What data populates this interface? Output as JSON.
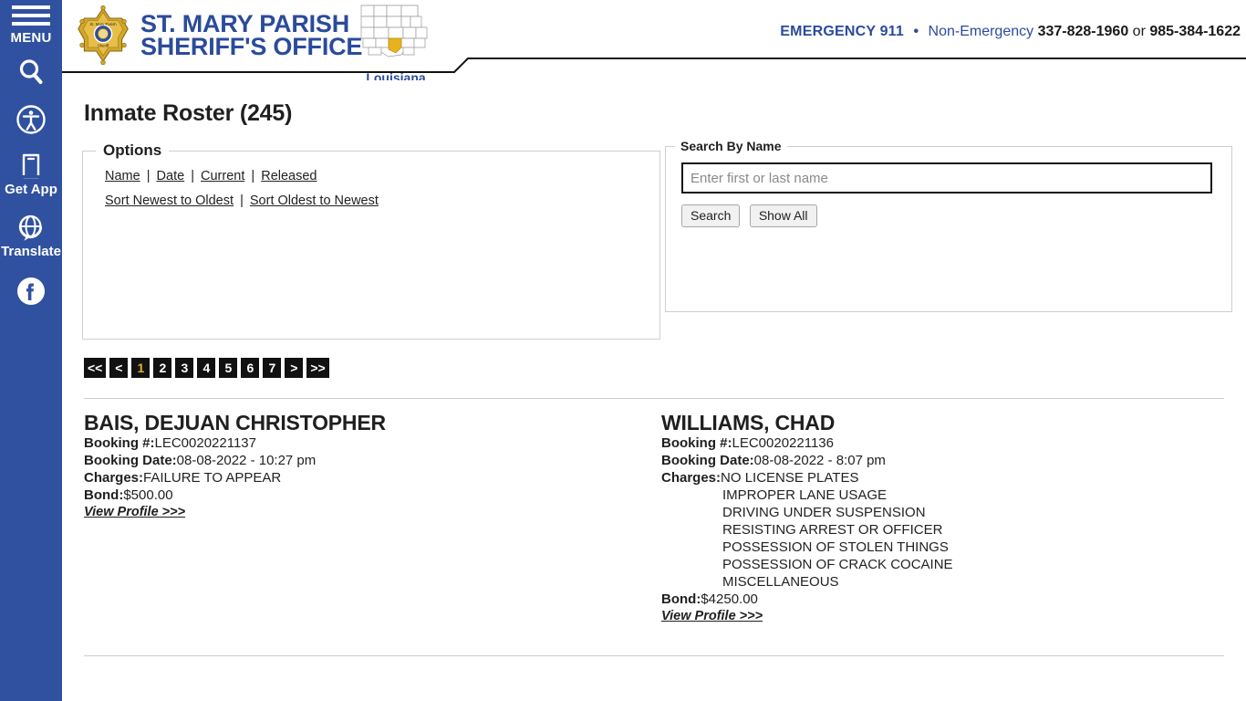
{
  "rail": {
    "menu_label": "MENU",
    "menu_icon": "hamburger-menu-icon",
    "search_icon": "search-icon",
    "items": [
      {
        "icon": "accessibility-icon",
        "label": ""
      },
      {
        "icon": "mobile-app-icon",
        "label": "Get App"
      },
      {
        "icon": "translate-globe-icon",
        "label": "Translate"
      },
      {
        "icon": "facebook-icon",
        "label": ""
      }
    ]
  },
  "header": {
    "badge_icon": "sheriff-star-badge-icon",
    "brand_line1": "ST. MARY PARISH",
    "brand_line2": "SHERIFF'S OFFICE",
    "state_map_icon": "louisiana-map-icon",
    "state_caption": "Louisiana",
    "emergency_label": "EMERGENCY 911",
    "separator": "•",
    "non_emergency_label": "Non-Emergency",
    "phone_primary": "337-828-1960",
    "conjunction": "or",
    "phone_secondary": "985-384-1622",
    "brand_color": "#2B4B9B",
    "rail_color": "#30519F"
  },
  "main": {
    "page_title": "Inmate Roster (245)",
    "options": {
      "legend": "Options",
      "filters": [
        "Name",
        "Date",
        "Current",
        "Released"
      ],
      "sorts": [
        "Sort Newest to Oldest",
        "Sort Oldest to Newest"
      ],
      "separator": "|"
    },
    "search": {
      "legend": "Search By Name",
      "input_value": "",
      "placeholder": "Enter first or last name",
      "search_button": "Search",
      "show_all_button": "Show All"
    },
    "pagination": {
      "first": "<<",
      "prev": "<",
      "pages": [
        "1",
        "2",
        "3",
        "4",
        "5",
        "6",
        "7"
      ],
      "current": "1",
      "next": ">",
      "last": ">>",
      "active_color": "#E8B21C"
    },
    "labels": {
      "booking_number": "Booking #:",
      "booking_date": "Booking Date:",
      "charges": "Charges:",
      "bond": "Bond:",
      "view_profile": "View Profile >>>"
    },
    "records": [
      {
        "name": "BAIS, DEJUAN CHRISTOPHER",
        "booking_number": "LEC0020221137",
        "booking_date": "08-08-2022 - 10:27 pm",
        "charges": [
          "FAILURE TO APPEAR"
        ],
        "bond": "$500.00"
      },
      {
        "name": "WILLIAMS, CHAD",
        "booking_number": "LEC0020221136",
        "booking_date": "08-08-2022 - 8:07 pm",
        "charges": [
          "NO LICENSE PLATES",
          "IMPROPER LANE USAGE",
          "DRIVING UNDER SUSPENSION",
          "RESISTING ARREST OR OFFICER",
          "POSSESSION OF STOLEN THINGS",
          "POSSESSION OF CRACK COCAINE",
          "MISCELLANEOUS"
        ],
        "bond": "$4250.00"
      }
    ]
  }
}
